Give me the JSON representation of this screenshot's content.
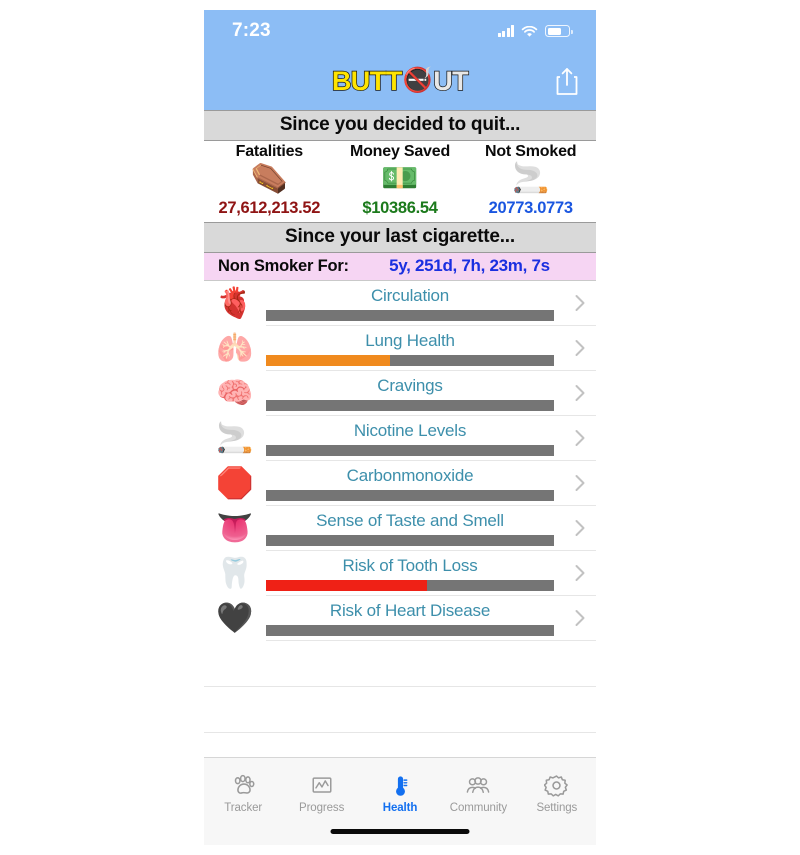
{
  "status_bar": {
    "time": "7:23",
    "signal_icon": "cellular-signal-icon",
    "wifi_icon": "wifi-icon",
    "battery_icon": "battery-icon"
  },
  "app_header": {
    "logo_part1": "BUTT",
    "logo_symbol": "🚭",
    "logo_part2": "UT",
    "share_icon": "share-icon"
  },
  "quit_section": {
    "header": "Since you decided to quit...",
    "stats": [
      {
        "label": "Fatalities",
        "emoji": "⚰️",
        "icon_name": "coffin-icon",
        "value": "27,612,213.52",
        "color": "#8f1414"
      },
      {
        "label": "Money Saved",
        "emoji": "💵",
        "icon_name": "money-icon",
        "value": "$10386.54",
        "color": "#1c7a1c"
      },
      {
        "label": "Not Smoked",
        "emoji": "🚬",
        "icon_name": "cigarette-icon",
        "value": "20773.0773",
        "color": "#1a56e0"
      }
    ]
  },
  "cigarette_section": {
    "header": "Since your last cigarette...",
    "non_smoker_label": "Non Smoker For:",
    "non_smoker_value": "5y, 251d, 7h, 23m, 7s"
  },
  "health_list": {
    "rows": [
      {
        "title": "Circulation",
        "emoji": "🫀",
        "icon_name": "heart-icon",
        "progress": 0,
        "fill_color": "#757575"
      },
      {
        "title": "Lung Health",
        "emoji": "🫁",
        "icon_name": "lungs-icon",
        "progress": 43,
        "fill_color": "#f08a1e"
      },
      {
        "title": "Cravings",
        "emoji": "🧠",
        "icon_name": "brain-icon",
        "progress": 0,
        "fill_color": "#757575"
      },
      {
        "title": "Nicotine Levels",
        "emoji": "🚬",
        "icon_name": "cigarette-icon",
        "progress": 0,
        "fill_color": "#757575"
      },
      {
        "title": "Carbonmonoxide",
        "emoji": "🛑",
        "icon_name": "co-sign-icon",
        "progress": 0,
        "fill_color": "#757575"
      },
      {
        "title": "Sense of Taste and Smell",
        "emoji": "👅",
        "icon_name": "tongue-icon",
        "progress": 0,
        "fill_color": "#757575"
      },
      {
        "title": "Risk of Tooth Loss",
        "emoji": "🦷",
        "icon_name": "tooth-icon",
        "progress": 56,
        "fill_color": "#ef2116"
      },
      {
        "title": "Risk of Heart Disease",
        "emoji": "🖤",
        "icon_name": "dark-heart-icon",
        "progress": 0,
        "fill_color": "#757575"
      }
    ],
    "chevron_icon": "chevron-right-icon",
    "empty_rows": 2
  },
  "tab_bar": {
    "tabs": [
      {
        "label": "Tracker",
        "icon": "paw-icon",
        "active": false
      },
      {
        "label": "Progress",
        "icon": "chart-icon",
        "active": false
      },
      {
        "label": "Health",
        "icon": "thermometer-icon",
        "active": true
      },
      {
        "label": "Community",
        "icon": "people-icon",
        "active": false
      },
      {
        "label": "Settings",
        "icon": "gear-icon",
        "active": false
      }
    ],
    "active_color": "#1370f0",
    "inactive_color": "#9a9a9a",
    "home_indicator": "home-indicator"
  }
}
